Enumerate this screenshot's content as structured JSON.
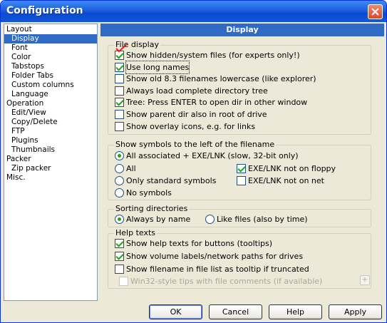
{
  "window": {
    "title": "Configuration"
  },
  "tree": [
    {
      "label": "Layout",
      "level": 1,
      "selected": false
    },
    {
      "label": "Display",
      "level": 2,
      "selected": true
    },
    {
      "label": "Font",
      "level": 2,
      "selected": false
    },
    {
      "label": "Color",
      "level": 2,
      "selected": false
    },
    {
      "label": "Tabstops",
      "level": 2,
      "selected": false
    },
    {
      "label": "Folder Tabs",
      "level": 2,
      "selected": false
    },
    {
      "label": "Custom columns",
      "level": 2,
      "selected": false
    },
    {
      "label": "Language",
      "level": 2,
      "selected": false
    },
    {
      "label": "Operation",
      "level": 1,
      "selected": false
    },
    {
      "label": "Edit/View",
      "level": 2,
      "selected": false
    },
    {
      "label": "Copy/Delete",
      "level": 2,
      "selected": false
    },
    {
      "label": "FTP",
      "level": 2,
      "selected": false
    },
    {
      "label": "Plugins",
      "level": 2,
      "selected": false
    },
    {
      "label": "Thumbnails",
      "level": 2,
      "selected": false
    },
    {
      "label": "Packer",
      "level": 1,
      "selected": false
    },
    {
      "label": "Zip packer",
      "level": 2,
      "selected": false
    },
    {
      "label": "Misc.",
      "level": 1,
      "selected": false
    }
  ],
  "panel": {
    "header": "Display"
  },
  "file_display": {
    "title": "File display",
    "options": [
      {
        "label": "Show hidden/system files (for experts only!)",
        "checked": true
      },
      {
        "label": "Use long names",
        "checked": true
      },
      {
        "label": "Show old 8.3 filenames lowercase (like explorer)",
        "checked": false
      },
      {
        "label": "Always load complete directory tree",
        "checked": false
      },
      {
        "label": "Tree: Press ENTER to open dir in other window",
        "checked": true
      },
      {
        "label": "Show parent dir also in root of drive",
        "checked": false
      },
      {
        "label": "Show overlay icons, e.g. for links",
        "checked": false
      }
    ]
  },
  "symbols": {
    "title": "Show symbols to the left of the filename",
    "radios": [
      {
        "label": "All associated + EXE/LNK (slow, 32-bit only)",
        "checked": true
      },
      {
        "label": "All",
        "checked": false
      },
      {
        "label": "Only standard symbols",
        "checked": false
      },
      {
        "label": "No symbols",
        "checked": false
      }
    ],
    "checks": [
      {
        "label": "EXE/LNK not on floppy",
        "checked": true
      },
      {
        "label": "EXE/LNK not on net",
        "checked": false
      }
    ]
  },
  "sorting": {
    "title": "Sorting directories",
    "radios": [
      {
        "label": "Always by name",
        "checked": true
      },
      {
        "label": "Like files (also by time)",
        "checked": false
      }
    ]
  },
  "help_texts": {
    "title": "Help texts",
    "options": [
      {
        "label": "Show help texts for buttons (tooltips)",
        "checked": true
      },
      {
        "label": "Show volume labels/network paths for drives",
        "checked": true
      },
      {
        "label": "Show filename in file list as tooltip if truncated",
        "checked": false
      },
      {
        "label": "Win32-style tips with file comments (if available)",
        "checked": false,
        "disabled": true
      }
    ],
    "plus_label": "+"
  },
  "buttons": {
    "ok": "OK",
    "cancel": "Cancel",
    "help": "Help",
    "apply": "Apply"
  }
}
